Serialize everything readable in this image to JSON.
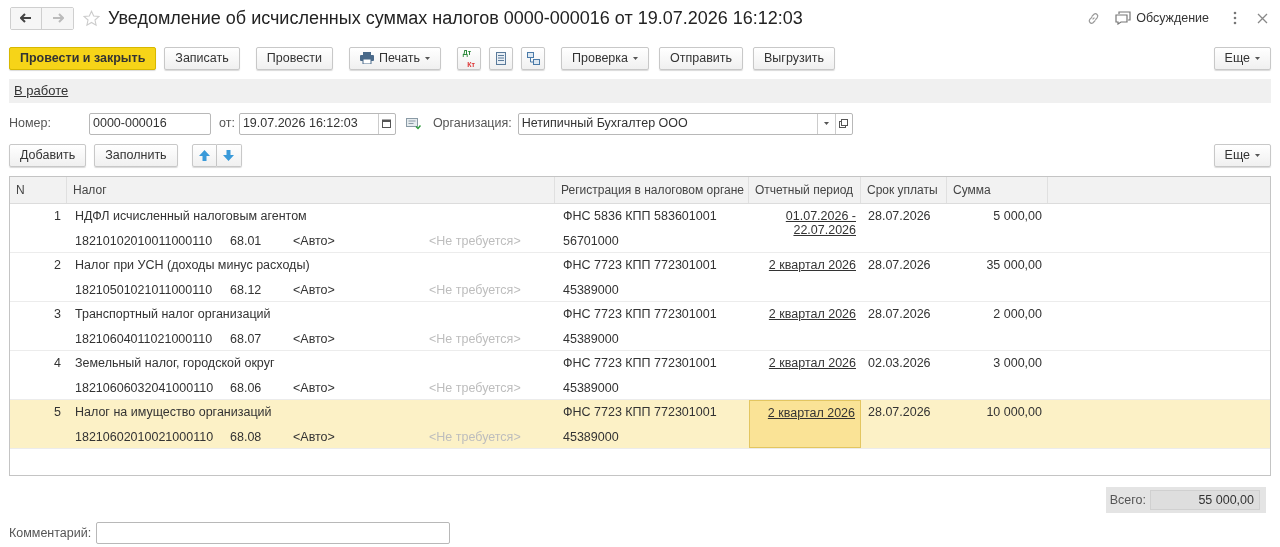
{
  "window": {
    "title": "Уведомление об исчисленных суммах налогов 0000-000016 от 19.07.2026 16:12:03",
    "discussion": "Обсуждение"
  },
  "toolbar": [
    {
      "kind": "primary",
      "label": "Провести и закрыть"
    },
    {
      "kind": "button",
      "label": "Записать"
    },
    {
      "kind": "button",
      "label": "Провести"
    },
    {
      "kind": "print",
      "label": "Печать"
    },
    {
      "kind": "dtkt",
      "label": "Дт",
      "sub": "Кт"
    },
    {
      "kind": "list"
    },
    {
      "kind": "structure"
    },
    {
      "kind": "menu",
      "label": "Проверка"
    },
    {
      "kind": "button",
      "label": "Отправить"
    },
    {
      "kind": "button",
      "label": "Выгрузить"
    }
  ],
  "more": "Еще",
  "status_link": "В работе",
  "fields": {
    "number_label": "Номер:",
    "number": "0000-000016",
    "date_label": "от:",
    "date": "19.07.2026 16:12:03",
    "org_label": "Организация:",
    "org": "Нетипичный Бухгалтер ООО"
  },
  "table_toolbar": {
    "add": "Добавить",
    "fill": "Заполнить",
    "more": "Еще"
  },
  "table": {
    "columns": [
      "N",
      "Налог",
      "Регистрация в налоговом органе",
      "Отчетный период",
      "Срок уплаты",
      "Сумма"
    ],
    "rows": [
      {
        "n": "1",
        "tax": "НДФЛ исчисленный налоговым агентом",
        "kbk": "18210102010011000110",
        "account": "68.01",
        "analytics": "<Авто>",
        "subconto": "<Не требуется>",
        "registration": "ФНС 5836 КПП 583601001",
        "oktmo": "56701000",
        "period": "01.07.2026 - 22.07.2026",
        "due": "28.07.2026",
        "sum": "5 000,00",
        "selected": false
      },
      {
        "n": "2",
        "tax": "Налог при УСН (доходы минус расходы)",
        "kbk": "18210501021011000110",
        "account": "68.12",
        "analytics": "<Авто>",
        "subconto": "<Не требуется>",
        "registration": "ФНС 7723 КПП 772301001",
        "oktmo": "45389000",
        "period": "2 квартал 2026",
        "due": "28.07.2026",
        "sum": "35 000,00",
        "selected": false
      },
      {
        "n": "3",
        "tax": "Транспортный налог организаций",
        "kbk": "18210604011021000110",
        "account": "68.07",
        "analytics": "<Авто>",
        "subconto": "<Не требуется>",
        "registration": "ФНС 7723 КПП 772301001",
        "oktmo": "45389000",
        "period": "2 квартал 2026",
        "due": "28.07.2026",
        "sum": "2 000,00",
        "selected": false
      },
      {
        "n": "4",
        "tax": "Земельный налог, городской округ",
        "kbk": "18210606032041000110",
        "account": "68.06",
        "analytics": "<Авто>",
        "subconto": "<Не требуется>",
        "registration": "ФНС 7723 КПП 772301001",
        "oktmo": "45389000",
        "period": "2 квартал 2026",
        "due": "02.03.2026",
        "sum": "3 000,00",
        "selected": false
      },
      {
        "n": "5",
        "tax": "Налог на имущество организаций",
        "kbk": "18210602010021000110",
        "account": "68.08",
        "analytics": "<Авто>",
        "subconto": "<Не требуется>",
        "registration": "ФНС 7723 КПП 772301001",
        "oktmo": "45389000",
        "period": "2 квартал 2026",
        "due": "28.07.2026",
        "sum": "10 000,00",
        "selected": true
      }
    ]
  },
  "total": {
    "label": "Всего:",
    "value": "55 000,00"
  },
  "comment": {
    "label": "Комментарий:"
  }
}
